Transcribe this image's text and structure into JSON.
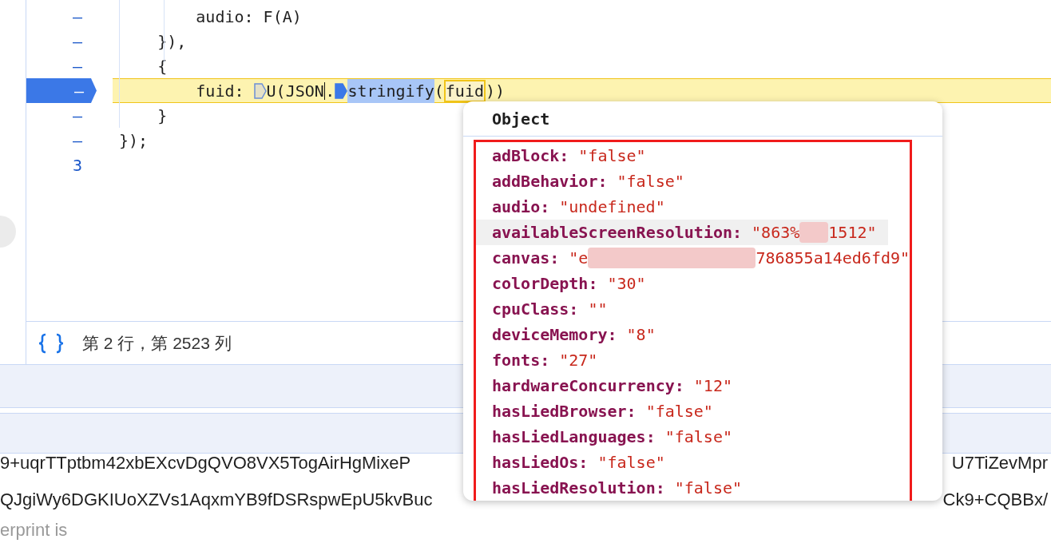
{
  "code_lines": [
    {
      "gutter": "–",
      "current": false,
      "segments": [
        {
          "kind": "text",
          "text": "        audio: F(A)"
        }
      ]
    },
    {
      "gutter": "–",
      "current": false,
      "segments": [
        {
          "kind": "text",
          "text": "    }),"
        }
      ]
    },
    {
      "gutter": "–",
      "current": false,
      "segments": [
        {
          "kind": "text",
          "text": "    {"
        }
      ]
    },
    {
      "gutter": "–",
      "current": true,
      "segments": [
        {
          "kind": "text",
          "text": "        fuid: "
        },
        {
          "kind": "marker",
          "active": false
        },
        {
          "kind": "text",
          "text": "U(JSON"
        },
        {
          "kind": "caret"
        },
        {
          "kind": "text",
          "text": "."
        },
        {
          "kind": "marker",
          "active": true
        },
        {
          "kind": "highlight",
          "text": "stringify"
        },
        {
          "kind": "text",
          "text": "("
        },
        {
          "kind": "boxed",
          "text": "fuid"
        },
        {
          "kind": "text",
          "text": "))"
        }
      ]
    },
    {
      "gutter": "–",
      "current": false,
      "segments": [
        {
          "kind": "text",
          "text": "    }"
        }
      ]
    },
    {
      "gutter": "–",
      "current": false,
      "segments": [
        {
          "kind": "text",
          "text": "});"
        }
      ]
    },
    {
      "gutter": "3",
      "current": false
    }
  ],
  "status_bar": {
    "position": "第 2 行，第 2523 列"
  },
  "output_lines": [
    {
      "left": "9+uqrTTptbm42xbEXcvDgQVO8VX5TogAirHgMixeP",
      "right": "U7TiZevMpr"
    },
    {
      "left": "QJgiWy6DGKIUoXZVs1AqxmYB9fDSRspwEpU5kvBuc",
      "right": "Ck9+CQBBx/"
    }
  ],
  "trailing_text": "erprint is",
  "popover": {
    "title": "Object",
    "properties": [
      {
        "key": "adBlock:",
        "hovered": false,
        "value_parts": [
          "\"false\""
        ]
      },
      {
        "key": "addBehavior:",
        "hovered": false,
        "value_parts": [
          "\"false\""
        ]
      },
      {
        "key": "audio:",
        "hovered": false,
        "value_parts": [
          "\"undefined\""
        ]
      },
      {
        "key": "availableScreenResolution:",
        "hovered": true,
        "value_parts": [
          "\"863%",
          "1512\""
        ]
      },
      {
        "key": "canvas:",
        "hovered": false,
        "value_parts": [
          "\"e",
          "786855a14ed6fd9\""
        ]
      },
      {
        "key": "colorDepth:",
        "hovered": false,
        "value_parts": [
          "\"30\""
        ]
      },
      {
        "key": "cpuClass:",
        "hovered": false,
        "value_parts": [
          "\"\""
        ]
      },
      {
        "key": "deviceMemory:",
        "hovered": false,
        "value_parts": [
          "\"8\""
        ]
      },
      {
        "key": "fonts:",
        "hovered": false,
        "value_parts": [
          "\"27\""
        ]
      },
      {
        "key": "hardwareConcurrency:",
        "hovered": false,
        "value_parts": [
          "\"12\""
        ]
      },
      {
        "key": "hasLiedBrowser:",
        "hovered": false,
        "value_parts": [
          "\"false\""
        ]
      },
      {
        "key": "hasLiedLanguages:",
        "hovered": false,
        "value_parts": [
          "\"false\""
        ]
      },
      {
        "key": "hasLiedOs:",
        "hovered": false,
        "value_parts": [
          "\"false\""
        ]
      },
      {
        "key": "hasLiedResolution:",
        "hovered": false,
        "value_parts": [
          "\"false\""
        ]
      }
    ]
  }
}
